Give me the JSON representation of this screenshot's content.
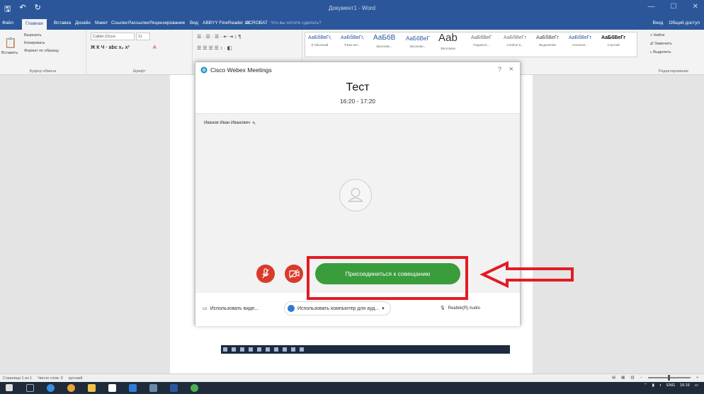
{
  "word": {
    "title": "Документ1 - Word",
    "tabs": [
      "Файл",
      "Главная",
      "Вставка",
      "Дизайн",
      "Макет",
      "Ссылки",
      "Рассылки",
      "Рецензирование",
      "Вид",
      "ABBYY FineReader 12",
      "ACROBAT"
    ],
    "tell_me": "Что вы хотите сделать?",
    "signin": "Вход",
    "share": "Общий доступ",
    "clipboard": {
      "paste": "Вставить",
      "cut": "Вырезать",
      "copy": "Копировать",
      "format_painter": "Формат по образцу",
      "label": "Буфер обмена"
    },
    "font": {
      "name": "Calibri (Осно",
      "size": "11",
      "label": "Шрифт"
    },
    "styles": [
      {
        "sample": "АаБбВвГг,",
        "name": "¶ Обычный"
      },
      {
        "sample": "АаБбВвГг,",
        "name": "¶ Без инт..."
      },
      {
        "sample": "АаБбВ",
        "name": "Заголово..."
      },
      {
        "sample": "АаБбВеГ",
        "name": "Заголово..."
      },
      {
        "sample": "Ааb",
        "name": "Заголовок"
      },
      {
        "sample": "АаБбВеГ",
        "name": "Подзагол..."
      },
      {
        "sample": "АаБбВеГг",
        "name": "Слабое в..."
      },
      {
        "sample": "АаБбВеГг",
        "name": "Выделение"
      },
      {
        "sample": "АаБбВеГг",
        "name": "Сильное..."
      },
      {
        "sample": "АаБбВеГг",
        "name": "Строгий"
      }
    ],
    "editing": {
      "find": "Найти",
      "replace": "Заменить",
      "select": "Выделить",
      "label": "Редактирование"
    },
    "status": {
      "page": "Страница 1 из 1",
      "words": "Число слов: 0",
      "language": "русский",
      "zoom": "+"
    }
  },
  "webex": {
    "app_title": "Cisco Webex Meetings",
    "help_icon": "?",
    "close_icon": "×",
    "meeting_title": "Тест",
    "meeting_time": "16:20 - 17:20",
    "user_name": "Иванов Иван Иванович",
    "join_label": "Присоединиться к совещанию",
    "video_option": "Использовать виде...",
    "audio_option": "Использовать компьютер для ауд...",
    "audio_device": "Realtek(R) Audio"
  },
  "taskbar": {
    "lang": "ENG",
    "time": "16:16"
  },
  "colors": {
    "word_blue": "#2b579a",
    "join_green": "#3a9d3c",
    "mute_red": "#d93a2b",
    "highlight_red": "#e31b23"
  }
}
